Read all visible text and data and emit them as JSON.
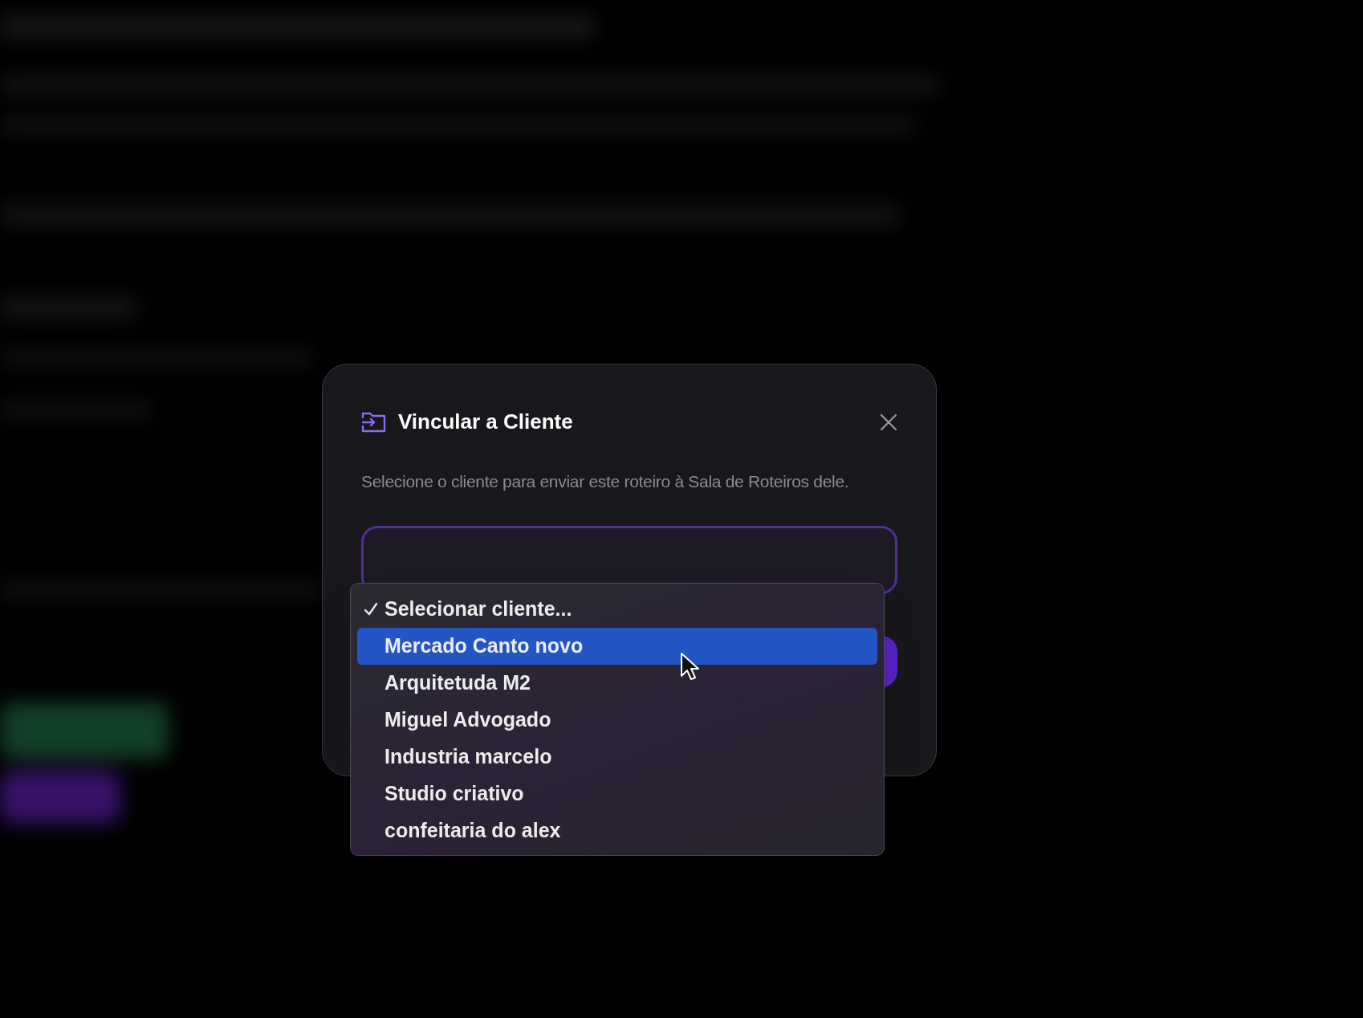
{
  "dialog": {
    "title": "Vincular a Cliente",
    "description": "Selecione o cliente para enviar este roteiro à Sala de Roteiros dele.",
    "select_menu": {
      "items": [
        {
          "label": "Selecionar cliente...",
          "checked": true,
          "selected": false
        },
        {
          "label": "Mercado Canto novo",
          "checked": false,
          "selected": true
        },
        {
          "label": "Arquitetuda M2",
          "checked": false,
          "selected": false
        },
        {
          "label": "Miguel Advogado",
          "checked": false,
          "selected": false
        },
        {
          "label": "Industria marcelo",
          "checked": false,
          "selected": false
        },
        {
          "label": "Studio criativo",
          "checked": false,
          "selected": false
        },
        {
          "label": "confeitaria do alex",
          "checked": false,
          "selected": false
        }
      ]
    }
  }
}
